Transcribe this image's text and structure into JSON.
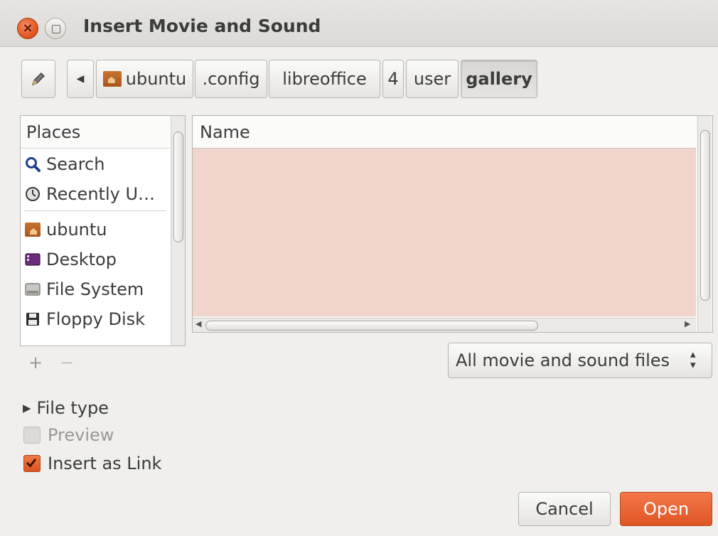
{
  "window": {
    "title": "Insert Movie and Sound"
  },
  "pathbar": {
    "items": [
      {
        "label": "ubuntu"
      },
      {
        "label": ".config"
      },
      {
        "label": "libreoffice"
      },
      {
        "label": "4"
      },
      {
        "label": "user"
      },
      {
        "label": "gallery"
      }
    ]
  },
  "places": {
    "header": "Places",
    "items": [
      {
        "label": "Search",
        "icon": "search-icon"
      },
      {
        "label": "Recently U…",
        "icon": "clock-icon"
      },
      {
        "label": "ubuntu",
        "icon": "home-folder-icon"
      },
      {
        "label": "Desktop",
        "icon": "desktop-icon"
      },
      {
        "label": "File System",
        "icon": "drive-icon"
      },
      {
        "label": "Floppy Disk",
        "icon": "floppy-icon"
      }
    ],
    "add": "+",
    "remove": "−"
  },
  "files": {
    "column_header": "Name"
  },
  "filter": {
    "selected": "All movie and sound files"
  },
  "options": {
    "file_type": "File type",
    "preview": {
      "label": "Preview",
      "checked": false,
      "enabled": false
    },
    "insert_as_link": {
      "label": "Insert as Link",
      "checked": true
    }
  },
  "buttons": {
    "cancel": "Cancel",
    "open": "Open"
  },
  "colors": {
    "accent": "#e2541f",
    "selection": "#f2d5ca"
  }
}
